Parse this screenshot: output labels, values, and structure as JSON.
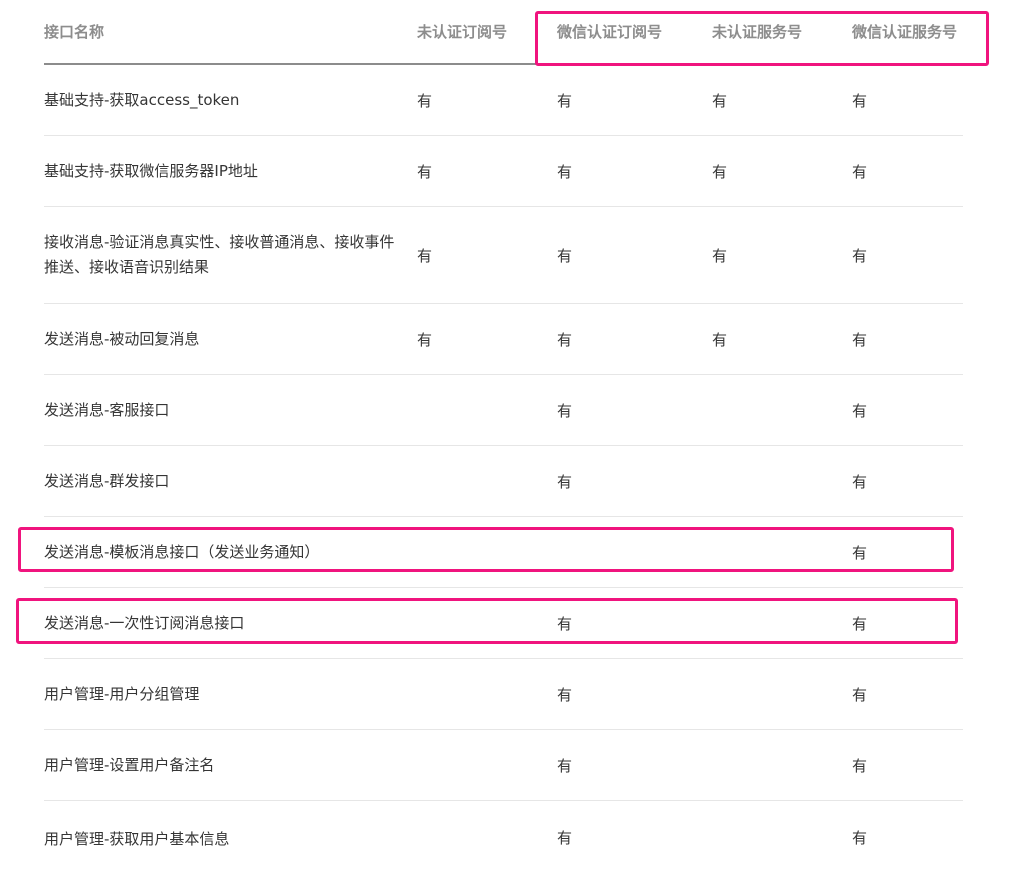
{
  "table": {
    "headers": [
      "接口名称",
      "未认证订阅号",
      "微信认证订阅号",
      "未认证服务号",
      "微信认证服务号"
    ],
    "rows": [
      {
        "name": "基础支持-获取access_token",
        "values": [
          "有",
          "有",
          "有",
          "有"
        ]
      },
      {
        "name": "基础支持-获取微信服务器IP地址",
        "values": [
          "有",
          "有",
          "有",
          "有"
        ]
      },
      {
        "name": "接收消息-验证消息真实性、接收普通消息、接收事件推送、接收语音识别结果",
        "values": [
          "有",
          "有",
          "有",
          "有"
        ]
      },
      {
        "name": "发送消息-被动回复消息",
        "values": [
          "有",
          "有",
          "有",
          "有"
        ]
      },
      {
        "name": "发送消息-客服接口",
        "values": [
          "",
          "有",
          "",
          "有"
        ]
      },
      {
        "name": "发送消息-群发接口",
        "values": [
          "",
          "有",
          "",
          "有"
        ]
      },
      {
        "name": "发送消息-模板消息接口（发送业务通知）",
        "values": [
          "",
          "",
          "",
          "有"
        ]
      },
      {
        "name": "发送消息-一次性订阅消息接口",
        "values": [
          "",
          "有",
          "",
          "有"
        ]
      },
      {
        "name": "用户管理-用户分组管理",
        "values": [
          "",
          "有",
          "",
          "有"
        ]
      },
      {
        "name": "用户管理-设置用户备注名",
        "values": [
          "",
          "有",
          "",
          "有"
        ]
      },
      {
        "name": "用户管理-获取用户基本信息",
        "values": [
          "",
          "有",
          "",
          "有"
        ]
      }
    ]
  },
  "highlight_color": "#f0147e",
  "header_color": "#8d8d8d",
  "text_color": "#353535"
}
